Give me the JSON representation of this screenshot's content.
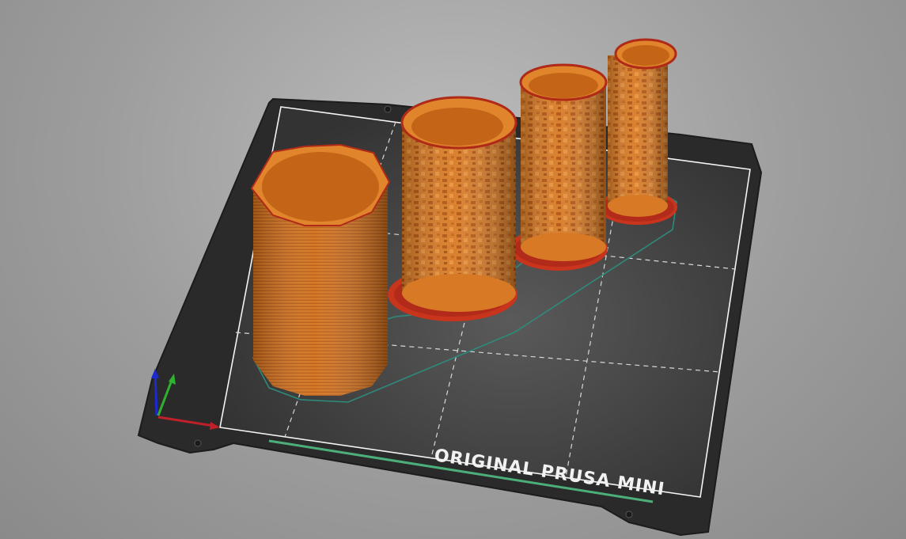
{
  "viewport": {
    "bed": {
      "label": "ORIGINAL PRUSA MINI",
      "sheet_color": "#2b2b2b",
      "surface_color": "#3d3d3d",
      "grid_color": "#d8d8d8",
      "accent_color": "#4caf7a"
    },
    "objects": [
      {
        "name": "octagonal-cup",
        "color": "#d4731f"
      },
      {
        "name": "textured-cylinder-large",
        "color": "#d4731f"
      },
      {
        "name": "textured-cylinder-medium",
        "color": "#d4731f"
      },
      {
        "name": "textured-cylinder-small",
        "color": "#d4731f"
      }
    ],
    "axes": {
      "x_color": "#c0202a",
      "y_color": "#30b030",
      "z_color": "#1a2ad0"
    },
    "convex_hull_color": "#2e8a7a"
  }
}
